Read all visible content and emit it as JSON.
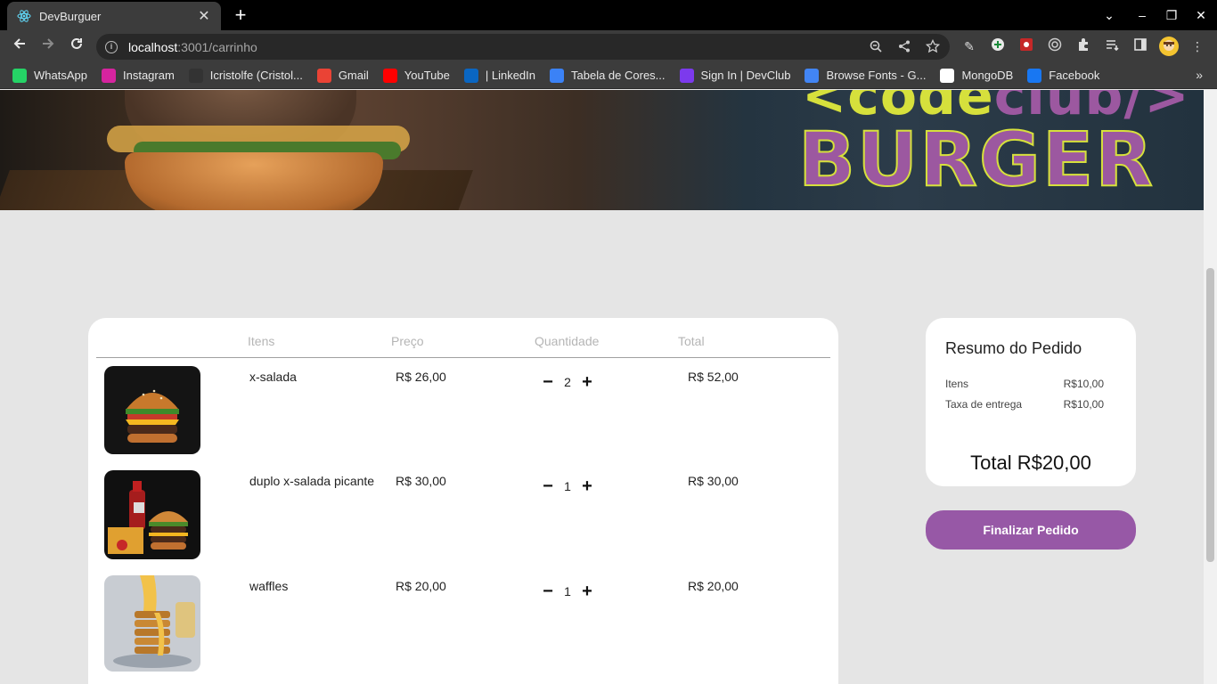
{
  "browser": {
    "tab_title": "DevBurguer",
    "tab_close": "✕",
    "new_tab": "+",
    "url_host": "localhost",
    "url_rest": ":3001/carrinho",
    "icons": [
      "back-icon",
      "forward-icon",
      "reload-icon",
      "info-icon",
      "zoom-icon",
      "share-icon",
      "star-icon",
      "extensions-icon",
      "menu-icon"
    ]
  },
  "bookmarks": [
    {
      "label": "WhatsApp",
      "icon": "whatsapp-icon",
      "color": "#25d366"
    },
    {
      "label": "Instagram",
      "icon": "instagram-icon",
      "color": "#d6249f"
    },
    {
      "label": "Icristolfe (Cristol...",
      "icon": "github-icon",
      "color": "#333333"
    },
    {
      "label": "Gmail",
      "icon": "gmail-icon",
      "color": "#ea4335"
    },
    {
      "label": "YouTube",
      "icon": "youtube-icon",
      "color": "#ff0000"
    },
    {
      "label": "| LinkedIn",
      "icon": "linkedin-icon",
      "color": "#0a66c2"
    },
    {
      "label": "Tabela de Cores...",
      "icon": "palette-icon",
      "color": "#3b82f6"
    },
    {
      "label": "Sign In | DevClub",
      "icon": "devclub-icon",
      "color": "#7c3aed"
    },
    {
      "label": "Browse Fonts - G...",
      "icon": "google-fonts-icon",
      "color": "#4285f4"
    },
    {
      "label": "MongoDB",
      "icon": "notion-icon",
      "color": "#ffffff"
    },
    {
      "label": "Facebook",
      "icon": "facebook-icon",
      "color": "#1877f2"
    }
  ],
  "bookmarks_more": "»",
  "banner": {
    "brand_top_a": "<code",
    "brand_top_b": "club/>",
    "brand_main": "BURGER"
  },
  "cart": {
    "headers": {
      "items": "Itens",
      "price": "Preço",
      "quantity": "Quantidade",
      "total": "Total"
    },
    "rows": [
      {
        "name": "x-salada",
        "price": "R$ 26,00",
        "qty": "2",
        "total": "R$ 52,00"
      },
      {
        "name": "duplo x-salada picante",
        "price": "R$ 30,00",
        "qty": "1",
        "total": "R$ 30,00"
      },
      {
        "name": "waffles",
        "price": "R$ 20,00",
        "qty": "1",
        "total": "R$ 20,00"
      }
    ],
    "minus": "−",
    "plus": "+"
  },
  "summary": {
    "title": "Resumo do Pedido",
    "items_label": "Itens",
    "items_value": "R$10,00",
    "delivery_label": "Taxa de entrega",
    "delivery_value": "R$10,00",
    "total": "Total R$20,00",
    "button": "Finalizar Pedido"
  },
  "colors": {
    "accent": "#9758a6",
    "brand_yellow": "#d6e03c"
  }
}
